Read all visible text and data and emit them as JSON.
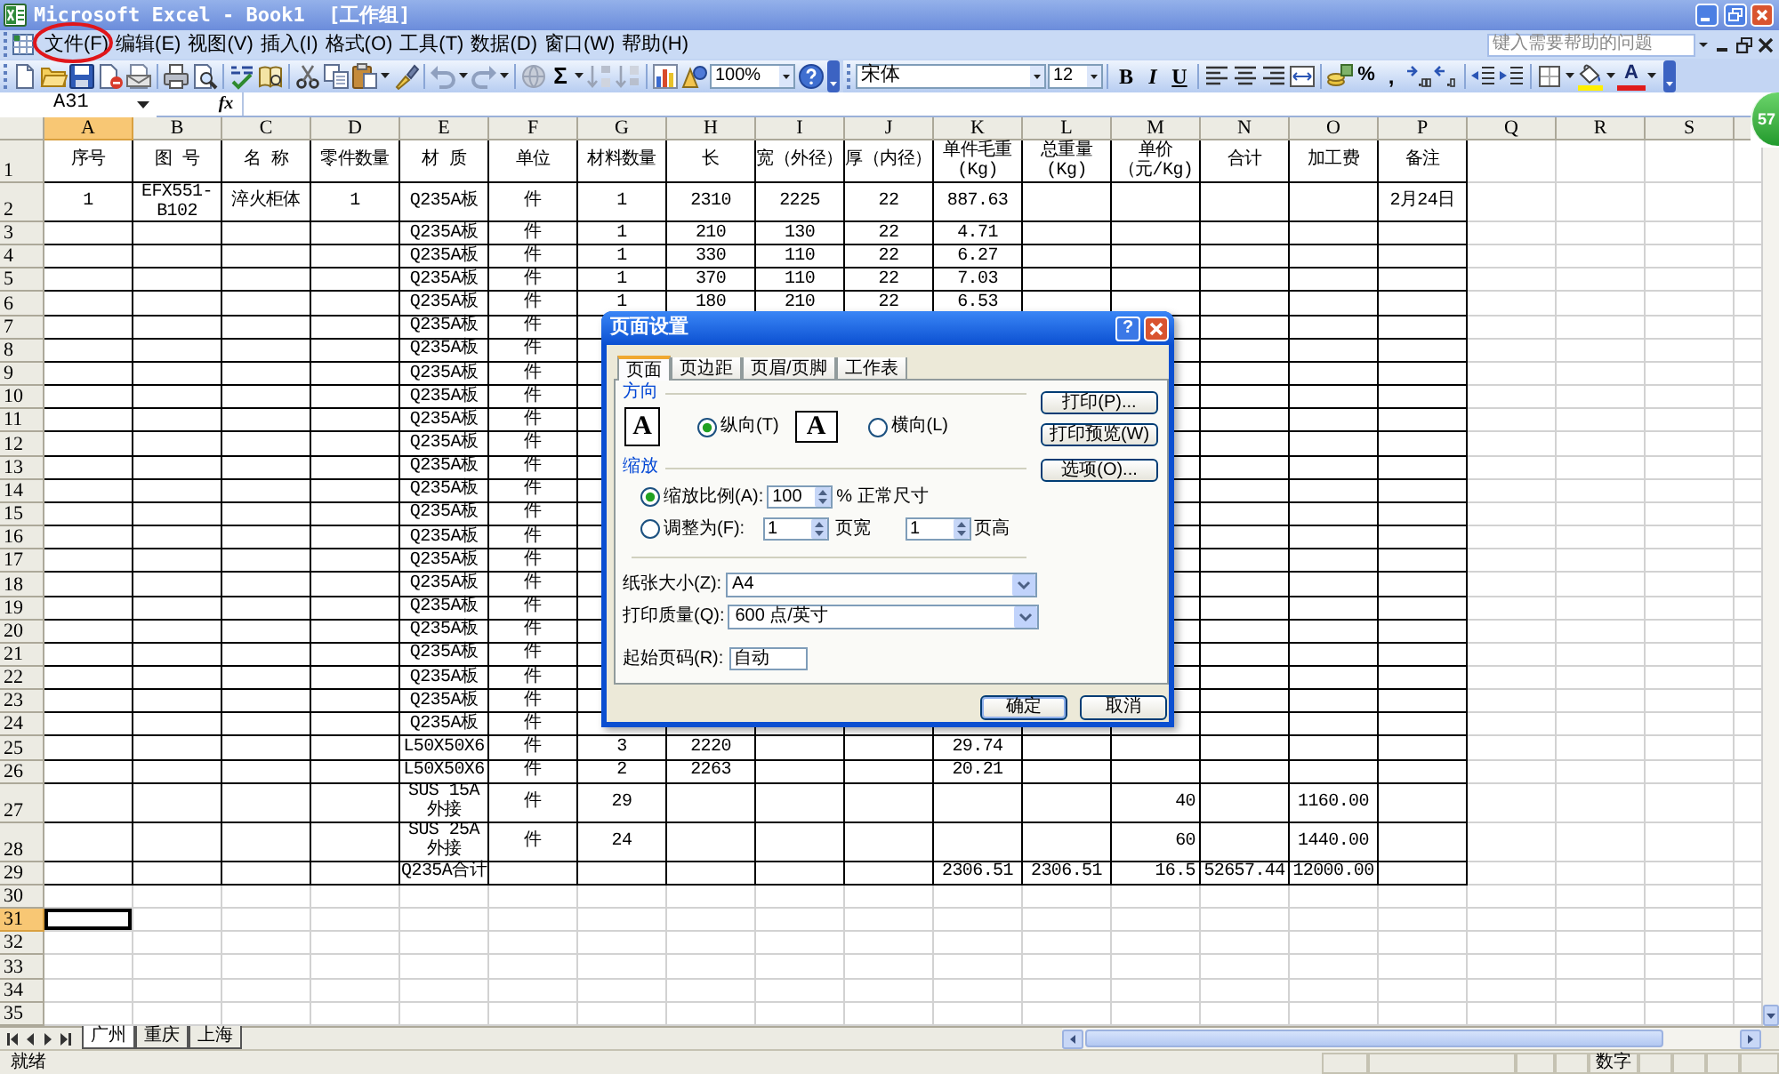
{
  "window": {
    "title": "Microsoft Excel - Book1  [工作组]"
  },
  "menu_bar": {
    "items": [
      "文件(F)",
      "编辑(E)",
      "视图(V)",
      "插入(I)",
      "格式(O)",
      "工具(T)",
      "数据(D)",
      "窗口(W)",
      "帮助(H)"
    ],
    "help_search": {
      "placeholder": "键入需要帮助的问题"
    }
  },
  "standard_toolbar": {
    "autosum": "Σ",
    "zoom": "100%"
  },
  "formatting_toolbar": {
    "font": "宋体",
    "font_size": "12",
    "bold": "B",
    "italic": "I",
    "underline": "U",
    "percent": "%",
    "comma": ",",
    "font_color": "A"
  },
  "formula_bar": {
    "name_box": "A31",
    "function_button": "fx"
  },
  "sheet": {
    "columns": [
      {
        "label": "A",
        "selected": true
      },
      {
        "label": "B",
        "selected": false
      },
      {
        "label": "C",
        "selected": false
      },
      {
        "label": "D",
        "selected": false
      },
      {
        "label": "E",
        "selected": false
      },
      {
        "label": "F",
        "selected": false
      },
      {
        "label": "G",
        "selected": false
      },
      {
        "label": "H",
        "selected": false
      },
      {
        "label": "I",
        "selected": false
      },
      {
        "label": "J",
        "selected": false
      },
      {
        "label": "K",
        "selected": false
      },
      {
        "label": "L",
        "selected": false
      },
      {
        "label": "M",
        "selected": false
      },
      {
        "label": "N",
        "selected": false
      },
      {
        "label": "O",
        "selected": false
      },
      {
        "label": "P",
        "selected": false
      },
      {
        "label": "Q",
        "selected": false
      },
      {
        "label": "R",
        "selected": false
      },
      {
        "label": "S",
        "selected": false
      }
    ],
    "rows": [
      {
        "label": "1",
        "selected": false,
        "cells": {
          "A": "序号",
          "B": "图 号",
          "C": "名 称",
          "D": "零件数量",
          "E": "材 质",
          "F": "单位",
          "G": "材料数量",
          "H": "长",
          "I": "宽（外径）",
          "J": "厚（内径）",
          "K": "单件毛重(Kg)",
          "L": "总重量(Kg)",
          "M": "单价（元/Kg)",
          "N": "合计",
          "O": "加工费",
          "P": "备注"
        }
      },
      {
        "label": "2",
        "selected": false,
        "cells": {
          "A": "1",
          "B": "EFX551-B102",
          "C": "淬火柜体",
          "D": "1",
          "E": "Q235A板",
          "F": "件",
          "G": "1",
          "H": "2310",
          "I": "2225",
          "J": "22",
          "K": "887.63",
          "P": "2月24日"
        }
      },
      {
        "label": "3",
        "selected": false,
        "cells": {
          "E": "Q235A板",
          "F": "件",
          "G": "1",
          "H": "210",
          "I": "130",
          "J": "22",
          "K": "4.71"
        }
      },
      {
        "label": "4",
        "selected": false,
        "cells": {
          "E": "Q235A板",
          "F": "件",
          "G": "1",
          "H": "330",
          "I": "110",
          "J": "22",
          "K": "6.27"
        }
      },
      {
        "label": "5",
        "selected": false,
        "cells": {
          "E": "Q235A板",
          "F": "件",
          "G": "1",
          "H": "370",
          "I": "110",
          "J": "22",
          "K": "7.03"
        }
      },
      {
        "label": "6",
        "selected": false,
        "cells": {
          "E": "Q235A板",
          "F": "件",
          "G": "1",
          "H": "180",
          "I": "210",
          "J": "22",
          "K": "6.53"
        }
      },
      {
        "label": "7",
        "selected": false,
        "cells": {
          "E": "Q235A板",
          "F": "件"
        }
      },
      {
        "label": "8",
        "selected": false,
        "cells": {
          "E": "Q235A板",
          "F": "件"
        }
      },
      {
        "label": "9",
        "selected": false,
        "cells": {
          "E": "Q235A板",
          "F": "件"
        }
      },
      {
        "label": "10",
        "selected": false,
        "cells": {
          "E": "Q235A板",
          "F": "件"
        }
      },
      {
        "label": "11",
        "selected": false,
        "cells": {
          "E": "Q235A板",
          "F": "件"
        }
      },
      {
        "label": "12",
        "selected": false,
        "cells": {
          "E": "Q235A板",
          "F": "件"
        }
      },
      {
        "label": "13",
        "selected": false,
        "cells": {
          "E": "Q235A板",
          "F": "件"
        }
      },
      {
        "label": "14",
        "selected": false,
        "cells": {
          "E": "Q235A板",
          "F": "件"
        }
      },
      {
        "label": "15",
        "selected": false,
        "cells": {
          "E": "Q235A板",
          "F": "件"
        }
      },
      {
        "label": "16",
        "selected": false,
        "cells": {
          "E": "Q235A板",
          "F": "件"
        }
      },
      {
        "label": "17",
        "selected": false,
        "cells": {
          "E": "Q235A板",
          "F": "件"
        }
      },
      {
        "label": "18",
        "selected": false,
        "cells": {
          "E": "Q235A板",
          "F": "件"
        }
      },
      {
        "label": "19",
        "selected": false,
        "cells": {
          "E": "Q235A板",
          "F": "件"
        }
      },
      {
        "label": "20",
        "selected": false,
        "cells": {
          "E": "Q235A板",
          "F": "件"
        }
      },
      {
        "label": "21",
        "selected": false,
        "cells": {
          "E": "Q235A板",
          "F": "件"
        }
      },
      {
        "label": "22",
        "selected": false,
        "cells": {
          "E": "Q235A板",
          "F": "件"
        }
      },
      {
        "label": "23",
        "selected": false,
        "cells": {
          "E": "Q235A板",
          "F": "件"
        }
      },
      {
        "label": "24",
        "selected": false,
        "cells": {
          "E": "Q235A板",
          "F": "件"
        }
      },
      {
        "label": "25",
        "selected": false,
        "cells": {
          "E": "L50X50X6",
          "F": "件",
          "G": "3",
          "H": "2220",
          "K": "29.74"
        }
      },
      {
        "label": "26",
        "selected": false,
        "cells": {
          "E": "L50X50X6",
          "F": "件",
          "G": "2",
          "H": "2263",
          "K": "20.21"
        }
      },
      {
        "label": "27",
        "selected": false,
        "cells": {
          "E": "SUS 15A外接",
          "F": "件",
          "G": "29",
          "M": "40",
          "O": "1160.00"
        }
      },
      {
        "label": "28",
        "selected": false,
        "cells": {
          "E": "SUS 25A外接",
          "F": "件",
          "G": "24",
          "M": "60",
          "O": "1440.00"
        }
      },
      {
        "label": "29",
        "selected": false,
        "cells": {
          "E": "Q235A合计",
          "K": "2306.51",
          "L": "2306.51",
          "M": "16.5",
          "N": "52657.44",
          "O": "12000.00"
        }
      },
      {
        "label": "30",
        "selected": false
      },
      {
        "label": "31",
        "selected": true
      },
      {
        "label": "32",
        "selected": false
      },
      {
        "label": "33",
        "selected": false
      },
      {
        "label": "34",
        "selected": false
      },
      {
        "label": "35",
        "selected": false
      }
    ]
  },
  "page_setup_dialog": {
    "title": "页面设置",
    "help_button": "?",
    "tabs": [
      {
        "label": "页面",
        "selected": true
      },
      {
        "label": "页边距",
        "selected": false
      },
      {
        "label": "页眉/页脚",
        "selected": false
      },
      {
        "label": "工作表",
        "selected": false
      }
    ],
    "orientation": {
      "heading": "方向",
      "options": [
        {
          "kind": "portrait",
          "icon_letter": "A",
          "label": "纵向(T)",
          "selected": true
        },
        {
          "kind": "landscape",
          "icon_letter": "A",
          "label": "横向(L)",
          "selected": false
        }
      ]
    },
    "scaling": {
      "heading": "缩放",
      "options": [
        {
          "kind": "percent",
          "label": "缩放比例(A):",
          "selected": true,
          "value": "100",
          "suffix": "% 正常尺寸"
        },
        {
          "kind": "fit",
          "label": "调整为(F):",
          "selected": false,
          "pages_wide": "1",
          "wide_label": "页宽",
          "pages_tall": "1",
          "tall_label": "页高"
        }
      ]
    },
    "paper_size": {
      "label": "纸张大小(Z):",
      "value": "A4"
    },
    "print_quality": {
      "label": "打印质量(Q):",
      "value": "600 点/英寸"
    },
    "first_page_number": {
      "label": "起始页码(R):",
      "value": "自动"
    },
    "side_buttons": [
      "打印(P)...",
      "打印预览(W)",
      "选项(O)..."
    ],
    "buttons": [
      {
        "label": "确定",
        "default": true
      },
      {
        "label": "取消",
        "default": false
      }
    ]
  },
  "sheet_tabs": [
    {
      "label": "广州",
      "selected": true
    },
    {
      "label": "重庆",
      "selected": false
    },
    {
      "label": "上海",
      "selected": false
    }
  ],
  "status_bar": {
    "status": "就绪",
    "mode": "数字"
  },
  "speed_ball": {
    "label": "57"
  }
}
